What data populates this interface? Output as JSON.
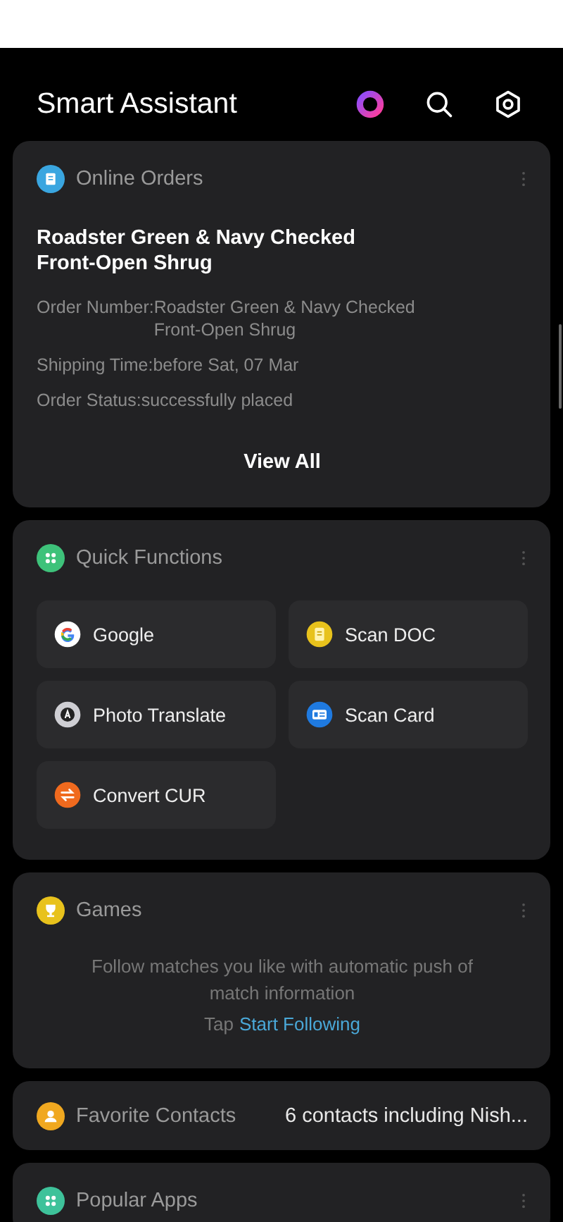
{
  "header": {
    "title": "Smart Assistant"
  },
  "cards": [
    {
      "kind": "orders",
      "title": "Online Orders",
      "color": "#3aa6e0",
      "product": "Roadster Green & Navy Checked Front-Open Shrug",
      "details": [
        {
          "label": "Order Number:",
          "value": "Roadster Green & Navy Checked Front-Open Shrug"
        },
        {
          "label": "Shipping Time:",
          "value": "before Sat, 07 Mar"
        },
        {
          "label": "Order Status:",
          "value": "successfully placed"
        }
      ],
      "action": "View All"
    },
    {
      "kind": "functions",
      "title": "Quick Functions",
      "color": "#3ec27a",
      "items": [
        {
          "label": "Google",
          "kind": "google"
        },
        {
          "label": "Scan DOC",
          "kind": "doc"
        },
        {
          "label": "Photo Translate",
          "kind": "translate"
        },
        {
          "label": "Scan Card",
          "kind": "card"
        },
        {
          "label": "Convert CUR",
          "kind": "currency"
        }
      ]
    },
    {
      "kind": "games",
      "title": "Games",
      "color": "#e8c21c",
      "message": "Follow matches you like with automatic push of match information",
      "prompt": "Tap",
      "link": "Start Following"
    },
    {
      "kind": "contacts",
      "title": "Favorite Contacts",
      "color": "#f0a820",
      "summary": "6 contacts including Nish..."
    },
    {
      "kind": "apps",
      "title": "Popular Apps",
      "color": "#3ec29a"
    }
  ]
}
